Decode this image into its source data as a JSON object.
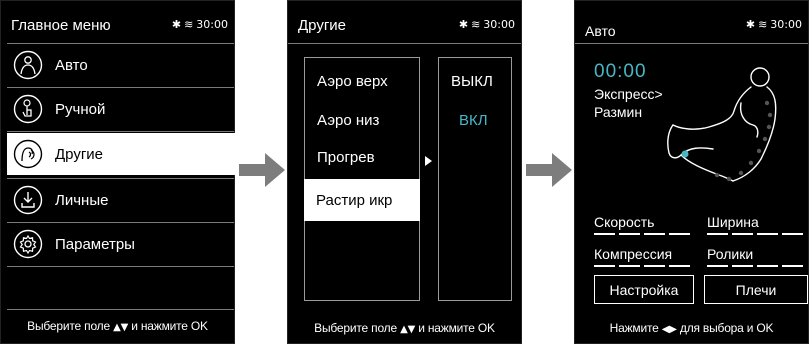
{
  "status": {
    "time": "30:00",
    "bluetooth_icon": "bluetooth-icon",
    "signal_icon": "wave-signal-icon"
  },
  "screen1": {
    "title": "Главное меню",
    "items": [
      {
        "label": "Авто",
        "icon": "body-silhouette-icon",
        "selected": false
      },
      {
        "label": "Ручной",
        "icon": "hand-touch-icon",
        "selected": false
      },
      {
        "label": "Другие",
        "icon": "head-waves-icon",
        "selected": true
      },
      {
        "label": "Личные",
        "icon": "download-icon",
        "selected": false
      },
      {
        "label": "Параметры",
        "icon": "gear-icon",
        "selected": false
      }
    ],
    "hint_prefix": "Выберите поле",
    "hint_arrows": "▲▼",
    "hint_suffix": "и нажмите OK"
  },
  "screen2": {
    "title": "Другие",
    "options": [
      {
        "label": "Аэро верх",
        "selected": false
      },
      {
        "label": "Аэро низ",
        "selected": false
      },
      {
        "label": "Прогрев",
        "selected": false
      },
      {
        "label": "Растир икр",
        "selected": true
      }
    ],
    "values": [
      {
        "label": "ВЫКЛ",
        "color": "#ffffff"
      },
      {
        "label": "ВКЛ",
        "color": "#49b6c6"
      }
    ],
    "hint_prefix": "Выберите поле",
    "hint_arrows": "▲▼",
    "hint_suffix": "и нажмите OK"
  },
  "screen3": {
    "title": "Авто",
    "time": "00:00",
    "mode_line1": "Экспресс>",
    "mode_line2": "Размин",
    "speed_label": "Скорость",
    "width_label": "Ширина",
    "compression_label": "Компрессия",
    "rollers_label": "Ролики",
    "setup_button": "Настройка",
    "shoulders_button": "Плечи",
    "hint_prefix": "Нажмите",
    "hint_arrows": "◀▶",
    "hint_suffix": "для выбора и OK"
  },
  "colors": {
    "accent": "#49b6c6",
    "background": "#000000",
    "text": "#ffffff"
  }
}
